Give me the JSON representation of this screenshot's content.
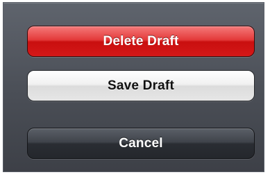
{
  "action_sheet": {
    "delete_label": "Delete Draft",
    "save_label": "Save Draft",
    "cancel_label": "Cancel"
  },
  "colors": {
    "destructive_red": "#d41818",
    "default_white": "#eeeeee",
    "cancel_dark": "#2a2d33",
    "sheet_background": "#4a4e56"
  }
}
